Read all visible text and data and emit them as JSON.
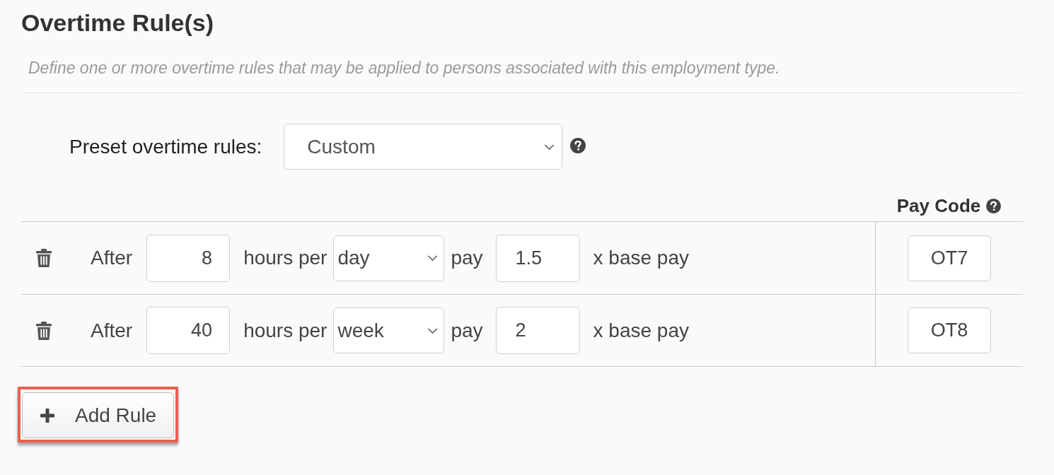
{
  "section": {
    "title": "Overtime Rule(s)",
    "description": "Define one or more overtime rules that may be applied to persons associated with this employment type."
  },
  "preset": {
    "label": "Preset overtime rules:",
    "value": "Custom"
  },
  "rules_table": {
    "pay_code_header": "Pay Code",
    "rows": [
      {
        "after_label": "After",
        "hours": "8",
        "hours_label": "hours per",
        "period": "day",
        "pay_label": "pay",
        "multiplier": "1.5",
        "multiplier_label": "x base pay",
        "pay_code": "OT7"
      },
      {
        "after_label": "After",
        "hours": "40",
        "hours_label": "hours per",
        "period": "week",
        "pay_label": "pay",
        "multiplier": "2",
        "multiplier_label": "x base pay",
        "pay_code": "OT8"
      }
    ]
  },
  "add_button": {
    "label": "Add Rule",
    "highlighted": true
  }
}
